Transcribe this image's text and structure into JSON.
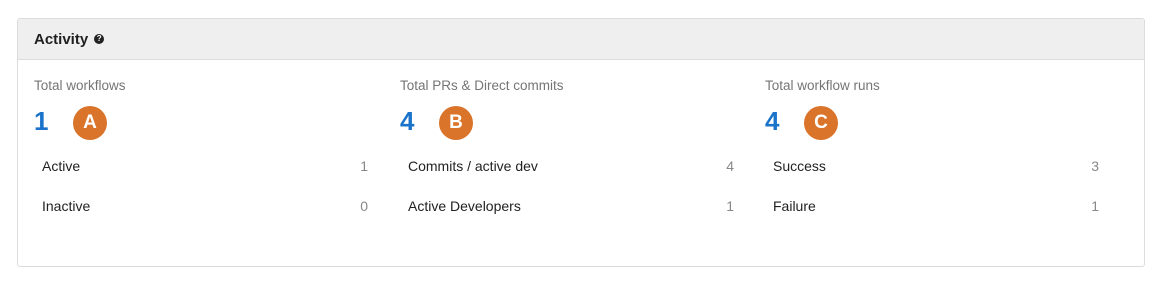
{
  "panel": {
    "title": "Activity",
    "help_icon": "question-circle-icon",
    "help_glyph": "?"
  },
  "columns": [
    {
      "label": "Total workflows",
      "total": "1",
      "badge": "A",
      "metrics": [
        {
          "label": "Active",
          "value": "1"
        },
        {
          "label": "Inactive",
          "value": "0"
        }
      ]
    },
    {
      "label": "Total PRs & Direct commits",
      "total": "4",
      "badge": "B",
      "metrics": [
        {
          "label": "Commits / active dev",
          "value": "4"
        },
        {
          "label": "Active Developers",
          "value": "1"
        }
      ]
    },
    {
      "label": "Total workflow runs",
      "total": "4",
      "badge": "C",
      "metrics": [
        {
          "label": "Success",
          "value": "3"
        },
        {
          "label": "Failure",
          "value": "1"
        }
      ]
    }
  ],
  "colors": {
    "total_number": "#1b74c9",
    "badge": "#d9742a",
    "header_bg": "#efefef"
  }
}
